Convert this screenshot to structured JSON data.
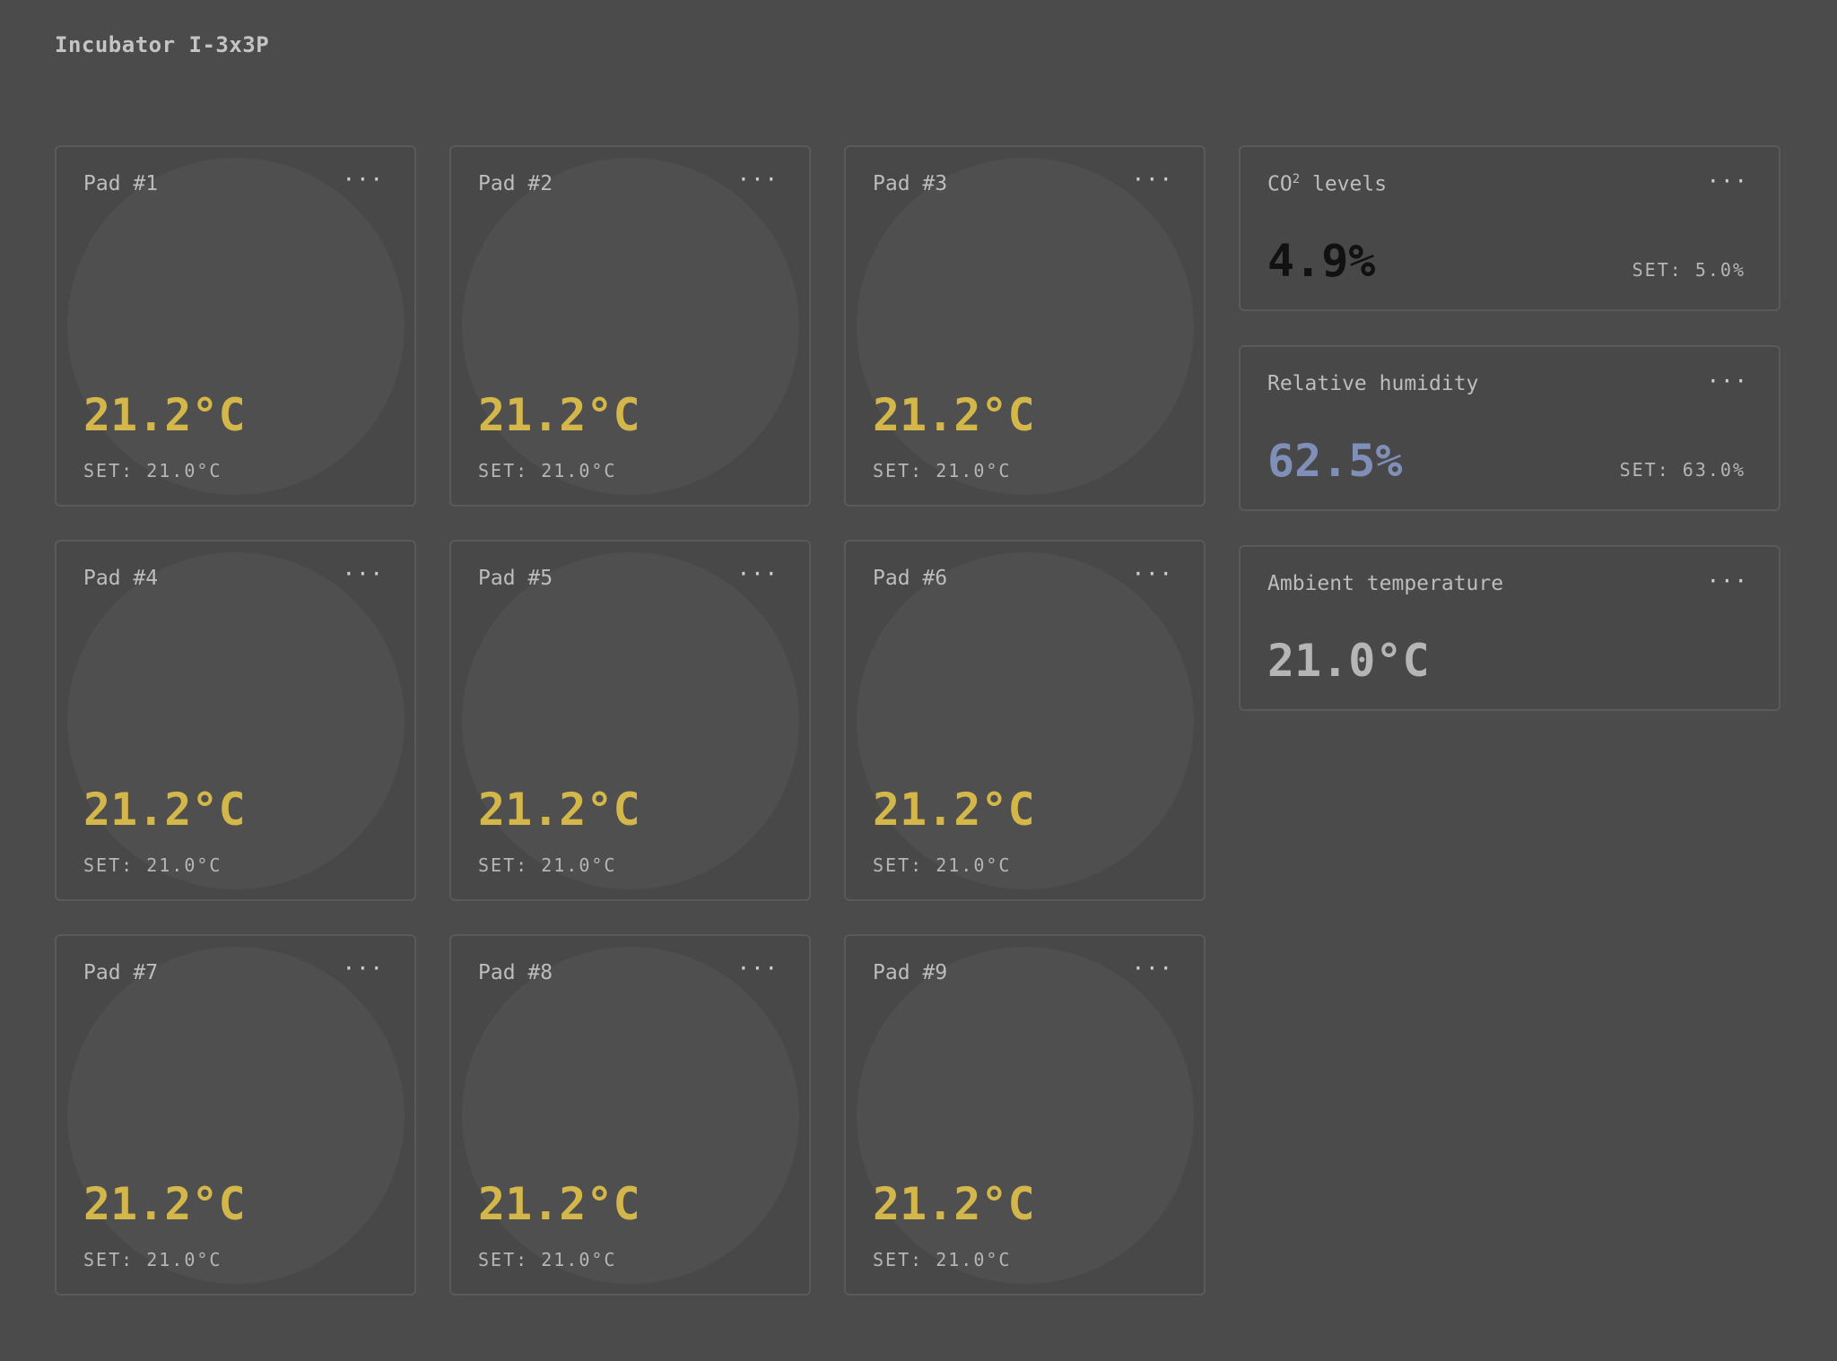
{
  "header": {
    "title": "Incubator I-3x3P"
  },
  "pads": [
    {
      "label": "Pad #1",
      "temp": "21.2°C",
      "set": "SET: 21.0°C"
    },
    {
      "label": "Pad #2",
      "temp": "21.2°C",
      "set": "SET: 21.0°C"
    },
    {
      "label": "Pad #3",
      "temp": "21.2°C",
      "set": "SET: 21.0°C"
    },
    {
      "label": "Pad #4",
      "temp": "21.2°C",
      "set": "SET: 21.0°C"
    },
    {
      "label": "Pad #5",
      "temp": "21.2°C",
      "set": "SET: 21.0°C"
    },
    {
      "label": "Pad #6",
      "temp": "21.2°C",
      "set": "SET: 21.0°C"
    },
    {
      "label": "Pad #7",
      "temp": "21.2°C",
      "set": "SET: 21.0°C"
    },
    {
      "label": "Pad #8",
      "temp": "21.2°C",
      "set": "SET: 21.0°C"
    },
    {
      "label": "Pad #9",
      "temp": "21.2°C",
      "set": "SET: 21.0°C"
    }
  ],
  "co2": {
    "label_main": "CO",
    "label_sup": "2",
    "label_rest": " levels",
    "value": "4.9%",
    "set": "SET: 5.0%"
  },
  "humidity": {
    "label": "Relative humidity",
    "value": "62.5%",
    "set": "SET: 63.0%"
  },
  "ambient": {
    "label": "Ambient temperature",
    "value": "21.0°C"
  },
  "menu_glyph": "···",
  "colors": {
    "pad_temp": "#d4b74a",
    "co2_value": "#111111",
    "humidity_value": "#7f8fb8",
    "ambient_value": "#b5b5b5"
  },
  "icons": {
    "card_menu": "more-horizontal-icon"
  }
}
